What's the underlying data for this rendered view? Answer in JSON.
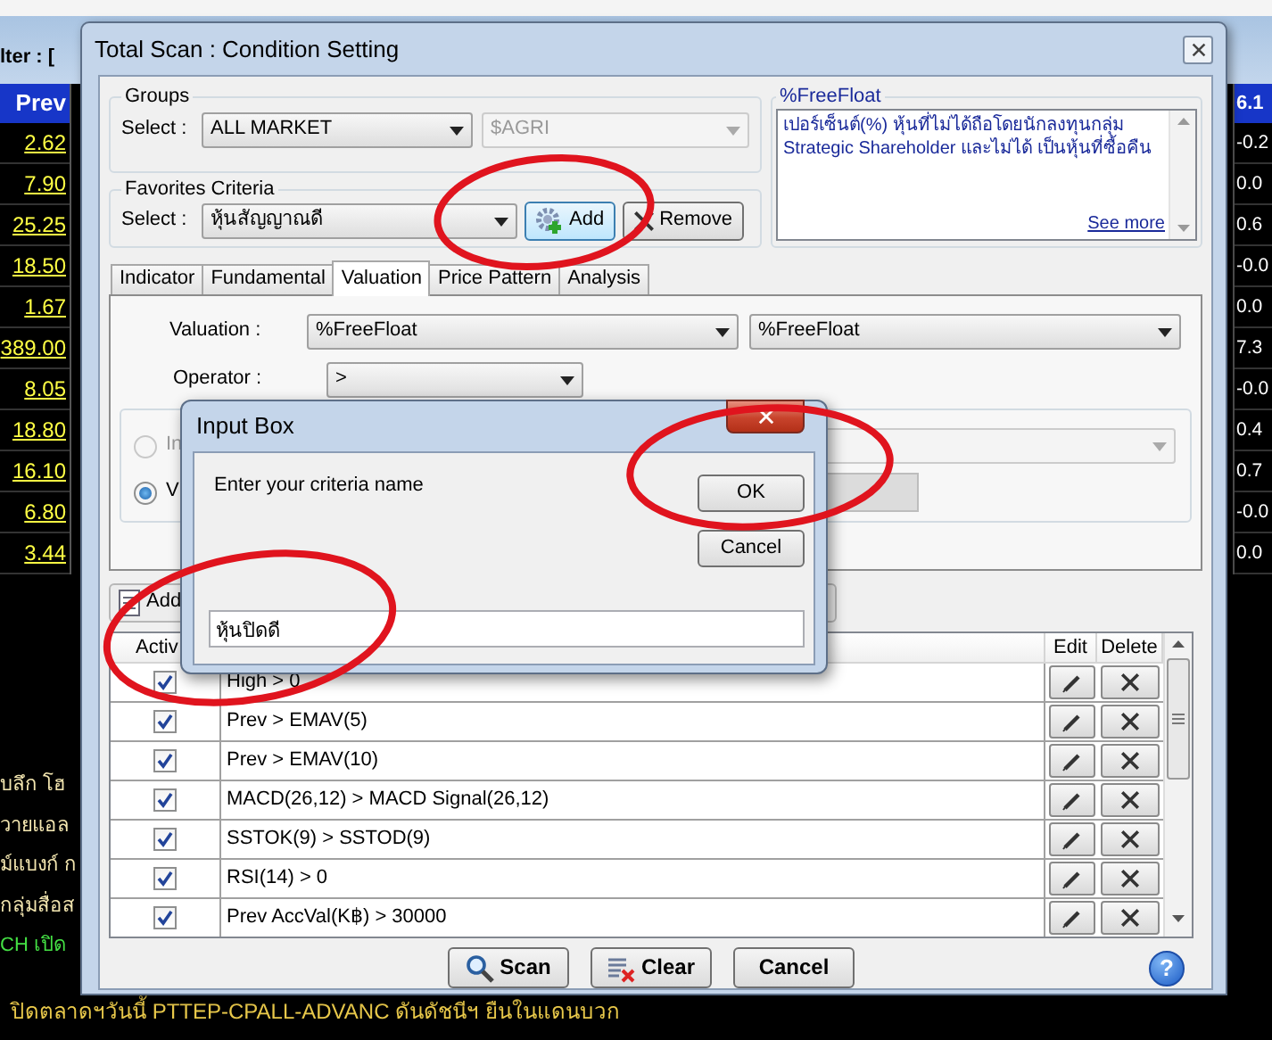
{
  "background": {
    "filter_label": "lter : [",
    "prev_header": "Prev",
    "prev_values": [
      "2.62",
      "7.90",
      "25.25",
      "18.50",
      "1.67",
      "389.00",
      "8.05",
      "18.80",
      "16.10",
      "6.80",
      "3.44"
    ],
    "change_header": "6.1",
    "change_values": [
      "-0.2",
      "0.0",
      "0.6",
      "-0.0",
      "0.0",
      "7.3",
      "-0.0",
      "0.4",
      "0.7",
      "-0.0",
      "0.0"
    ],
    "news": [
      {
        "text": "บลึก โฮ",
        "color": "#f3e6b0"
      },
      {
        "text": "วายแอล",
        "color": "#f3e6b0"
      },
      {
        "text": "ม์แบงก์ ก",
        "color": "#f3e6b0"
      },
      {
        "text": "กลุ่มสื่อส",
        "color": "#f3e6b0"
      },
      {
        "text": "CH เปิด",
        "color": "#44e044"
      },
      {
        "text": "ปิดตลาดฯวันนี้ PTTEP-CPALL-ADVANC ดันดัชนีฯ ยืนในแดนบวก",
        "color": "#e8c84a"
      }
    ]
  },
  "dialog": {
    "title": "Total Scan : Condition Setting",
    "groups": {
      "legend": "Groups",
      "select_label": "Select :",
      "value": "ALL MARKET",
      "sub_value": "$AGRI"
    },
    "favorites": {
      "legend": "Favorites Criteria",
      "select_label": "Select :",
      "value": "หุ้นสัญญาณดี",
      "add_button": "Add",
      "remove_button": "Remove"
    },
    "description": {
      "legend": "%FreeFloat",
      "text": "เปอร์เซ็นต์(%) หุ้นที่ไม่ได้ถือโดยนักลงทุนกลุ่ม Strategic Shareholder และไม่ได้ เป็นหุ้นที่ซื้อคืน",
      "link": "See more"
    },
    "tabs": [
      {
        "label": "Indicator",
        "selected": false
      },
      {
        "label": "Fundamental",
        "selected": false
      },
      {
        "label": "Valuation",
        "selected": true
      },
      {
        "label": "Price Pattern",
        "selected": false
      },
      {
        "label": "Analysis",
        "selected": false
      }
    ],
    "valuation": {
      "label": "Valuation :",
      "value": "%FreeFloat",
      "compare_value": "%FreeFloat",
      "operator_label": "Operator :",
      "operator": ">",
      "options": [
        {
          "label": "In",
          "selected": false,
          "disabled": true
        },
        {
          "label": "V",
          "selected": true,
          "disabled": false
        }
      ]
    },
    "toolbar": {
      "add_button": "Add"
    },
    "table": {
      "columns": [
        "Activ",
        "Edit",
        "Delete"
      ],
      "rows": [
        {
          "active": true,
          "condition": "High > 0"
        },
        {
          "active": true,
          "condition": "Prev > EMAV(5)"
        },
        {
          "active": true,
          "condition": "Prev > EMAV(10)"
        },
        {
          "active": true,
          "condition": "MACD(26,12) > MACD Signal(26,12)"
        },
        {
          "active": true,
          "condition": "SSTOK(9) > SSTOD(9)"
        },
        {
          "active": true,
          "condition": "RSI(14) > 0"
        },
        {
          "active": true,
          "condition": "Prev AccVal(K฿) > 30000"
        }
      ]
    },
    "buttons": [
      {
        "kind": "scan",
        "label": "Scan"
      },
      {
        "kind": "clear",
        "label": "Clear"
      },
      {
        "kind": "cancel",
        "label": "Cancel"
      }
    ],
    "help": "?"
  },
  "input_box": {
    "title": "Input Box",
    "prompt": "Enter your criteria name",
    "ok_button": "OK",
    "cancel_button": "Cancel",
    "value": "หุ้นปิดดี"
  }
}
